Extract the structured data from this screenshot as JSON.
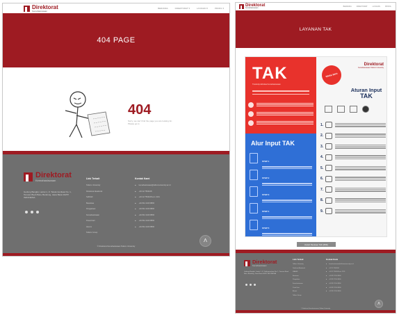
{
  "left": {
    "brand": {
      "name": "Direktorat",
      "sub": "Kemahasiswaan"
    },
    "nav": [
      "BERANDA",
      "DIREKTORAT ▾",
      "LAYANAN ▾",
      "PROFIL ▾"
    ],
    "banner_title": "404 PAGE",
    "error_code": "404",
    "error_message": "Sorry, we can't find the page you are looking for. Please go to",
    "footer": {
      "brand": {
        "name": "Direktorat",
        "sub": "Kemahasiswaan"
      },
      "address": "Gedung Bangkit, Lantai 1, Jl. Telekomunikasi No. 1, Terusan Buah Batu, Bandung, Jawa Barat 40257 INDONESIA",
      "links_heading": "Link Terkait",
      "links": [
        "Telkom University",
        "Direktorat Akademik",
        "SIAKAD",
        "Beasiswa",
        "Pengaduan",
        "Kemahasiswaan",
        "Pusat Karir",
        "Alumni",
        "Telkom Group"
      ],
      "contact_heading": "Kontak Kami",
      "contact": [
        "kemahasiswaan@telkomuniversity.ac.id",
        "+62 22 7564108",
        "+62 22 7564108 ext. 2131",
        "+62 812 2100 8800",
        "+62 812 2100 8800",
        "+62 812 2100 8800",
        "+62 812 2100 8800",
        "+62 812 2100 8800"
      ],
      "copyright": "© Direktorat Kemahasiswaan Telkom University"
    },
    "scroll_top": "Λ"
  },
  "right": {
    "brand": {
      "name": "Direktorat",
      "sub": "Kemahasiswaan"
    },
    "nav": [
      "BERANDA",
      "DIREKTORAT",
      "LAYANAN",
      "PROFIL"
    ],
    "banner_title": "LAYANAN TAK",
    "poster": {
      "title": "TAK",
      "subtitle": "Transkrip Aktivitas Kemahasiswaan",
      "tag": "SIMAK INFO",
      "brand": {
        "name": "Direktorat",
        "sub": "Kemahasiswaan Telkom University"
      },
      "flow_title": "Alur Input TAK",
      "steps": [
        "STEP 1",
        "STEP 2",
        "STEP 3",
        "STEP 4",
        "STEP 5"
      ],
      "rules_title_1": "Aturan Input",
      "rules_title_2": "TAK",
      "rule_numbers": [
        "1.",
        "2.",
        "3.",
        "4.",
        "5.",
        "6.",
        "7.",
        "8.",
        "9."
      ]
    },
    "download_button": "Unduh Panduan TAK (PDF)",
    "footer": {
      "brand": {
        "name": "Direktorat",
        "sub": "Kemahasiswaan"
      },
      "address": "Gedung Bangkit, Lantai 1, Jl. Telekomunikasi No. 1, Terusan Buah Batu, Bandung, Jawa Barat 40257 INDONESIA",
      "links_heading": "Link Terkait",
      "links": [
        "Telkom University",
        "Direktorat Akademik",
        "SIAKAD",
        "Beasiswa",
        "Pengaduan",
        "Kemahasiswaan",
        "Pusat Karir",
        "Alumni",
        "Telkom Group"
      ],
      "contact_heading": "Kontak Kami",
      "contact": [
        "kemahasiswaan@telkomuniversity.ac.id",
        "+62 22 7564108",
        "+62 22 7564108 ext. 2131",
        "+62 812 2100 8800",
        "+62 812 2100 8800",
        "+62 812 2100 8800",
        "+62 812 2100 8800",
        "+62 812 2100 8800"
      ],
      "copyright": "© Direktorat Kemahasiswaan Telkom University"
    },
    "scroll_top": "Λ"
  },
  "colors": {
    "brand_red": "#9e1b22",
    "footer_gray": "#6f6f6f",
    "poster_red": "#e8322c",
    "poster_blue": "#2f6fd6"
  }
}
